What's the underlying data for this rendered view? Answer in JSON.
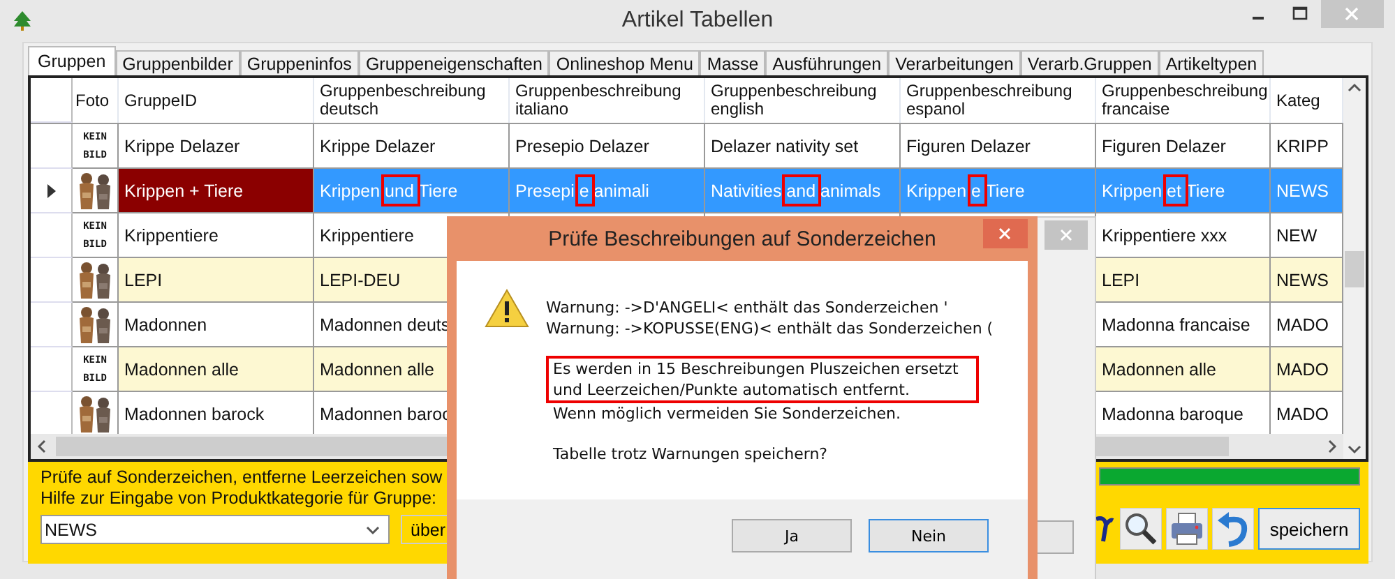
{
  "window": {
    "title": "Artikel Tabellen"
  },
  "tabs": [
    {
      "label": "Gruppen",
      "selected": true
    },
    {
      "label": "Gruppenbilder",
      "selected": false
    },
    {
      "label": "Gruppeninfos",
      "selected": false
    },
    {
      "label": "Gruppeneigenschaften",
      "selected": false
    },
    {
      "label": "Onlineshop Menu",
      "selected": false
    },
    {
      "label": "Masse",
      "selected": false
    },
    {
      "label": "Ausführungen",
      "selected": false
    },
    {
      "label": "Verarbeitungen",
      "selected": false
    },
    {
      "label": "Verarb.Gruppen",
      "selected": false
    },
    {
      "label": "Artikeltypen",
      "selected": false
    }
  ],
  "table": {
    "photo_header": "Foto",
    "columns": [
      "GruppeID",
      "Gruppenbeschreibung deutsch",
      "Gruppenbeschreibung italiano",
      "Gruppenbeschreibung english",
      "Gruppenbeschreibung espanol",
      "Gruppenbeschreibung francaise",
      "Kateg"
    ],
    "rows": [
      {
        "selected": false,
        "highlighted": false,
        "photo": {
          "kind": "text",
          "text": "KEIN BILD"
        },
        "cells": [
          "Krippe Delazer",
          "Krippe Delazer",
          "Presepio Delazer",
          "Delazer nativity set",
          "Figuren Delazer",
          "Figuren Delazer",
          "KRIPP"
        ]
      },
      {
        "selected": true,
        "highlighted": false,
        "cells": [
          "Krippen + Tiere",
          "Krippen und Tiere",
          "Presepi e animali",
          "Nativities and animals",
          "Krippen e Tiere",
          "Krippen et Tiere",
          "NEWS"
        ],
        "marked": [
          false,
          true,
          true,
          true,
          true,
          true,
          false
        ]
      },
      {
        "selected": false,
        "highlighted": false,
        "photo": {
          "kind": "text",
          "text": "KEIN BILD"
        },
        "cells": [
          "Krippentiere",
          "Krippentiere",
          "",
          "",
          "",
          "Krippentiere xxx",
          "NEW"
        ]
      },
      {
        "selected": false,
        "highlighted": true,
        "cells": [
          "LEPI",
          "LEPI-DEU",
          "",
          "",
          "",
          "LEPI",
          "NEWS"
        ]
      },
      {
        "selected": false,
        "highlighted": false,
        "cells": [
          "Madonnen",
          "Madonnen deuts",
          "",
          "",
          "",
          "Madonna francaise",
          "MADO"
        ]
      },
      {
        "selected": false,
        "highlighted": true,
        "photo": {
          "kind": "text",
          "text": "KEIN BILD"
        },
        "cells": [
          "Madonnen alle",
          "Madonnen alle",
          "",
          "",
          "",
          "Madonnen alle",
          "MADO"
        ]
      },
      {
        "selected": false,
        "highlighted": false,
        "cells": [
          "Madonnen barock",
          "Madonnen baroc",
          "",
          "",
          "",
          "Madonna baroque",
          "MADO"
        ]
      }
    ]
  },
  "footer": {
    "lines": [
      "Prüfe auf Sonderzeichen, entferne Leerzeichen sow",
      "Hilfe zur Eingabe von Produktkategorie für Gruppe:"
    ],
    "category": "NEWS",
    "apply_button": "über",
    "progress": {
      "level": 1
    },
    "save_button": "speichern"
  },
  "dialog": {
    "title": "Prüfe Beschreibungen auf Sonderzeichen",
    "warnings": [
      "Warnung: ->D'ANGELI< enthält das Sonderzeichen '",
      "Warnung: ->KOPUSSE(ENG)< enthält das Sonderzeichen ("
    ],
    "notice": "Es werden in 15 Beschreibungen Pluszeichen ersetzt und Leerzeichen/Punkte automatisch entfernt.",
    "hint": "Wenn möglich vermeiden Sie Sonderzeichen.",
    "question": "Tabelle trotz Warnungen speichern?",
    "buttons": [
      {
        "label": "Ja",
        "focused": false
      },
      {
        "label": "Nein",
        "focused": true
      }
    ]
  }
}
